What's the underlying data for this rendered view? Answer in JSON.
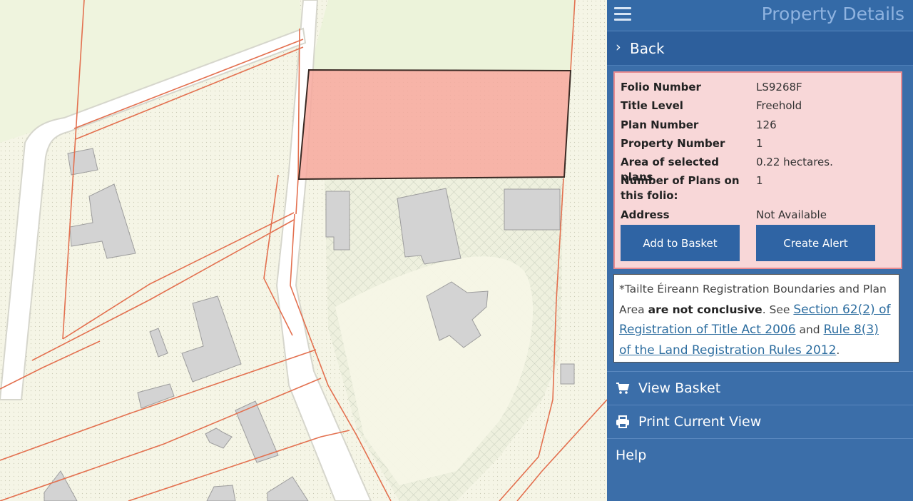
{
  "header": {
    "title": "Property Details"
  },
  "back": {
    "label": "Back"
  },
  "details": {
    "fields": [
      {
        "label": "Folio Number",
        "value": "LS9268F"
      },
      {
        "label": "Title Level",
        "value": "Freehold"
      },
      {
        "label": "Plan Number",
        "value": "126"
      },
      {
        "label": "Property Number",
        "value": "1"
      },
      {
        "label": "Area of selected plans",
        "value": "0.22 hectares."
      },
      {
        "label": "Number of Plans on this folio:",
        "value": "1"
      },
      {
        "label": "Address",
        "value": "Not Available"
      }
    ],
    "add_to_basket_label": "Add to Basket",
    "create_alert_label": "Create Alert"
  },
  "notice": {
    "text1": "*Tailte Éireann Registration Boundaries and Plan Area ",
    "bold": "are not conclusive",
    "text2": ". See ",
    "link1": "Section 62(2) of Registration of Title Act 2006",
    "text3": " and ",
    "link2": "Rule 8(3) of the Land Registration Rules 2012",
    "text4": "."
  },
  "menu": {
    "view_basket": "View Basket",
    "print_view": "Print Current View",
    "help": "Help"
  },
  "colors": {
    "panel_bg": "#3b6ea9",
    "details_bg": "#f8d7d8",
    "button_bg": "#2f64a4",
    "plot_fill": "#f7a89c",
    "boundary": "#e3704f"
  }
}
